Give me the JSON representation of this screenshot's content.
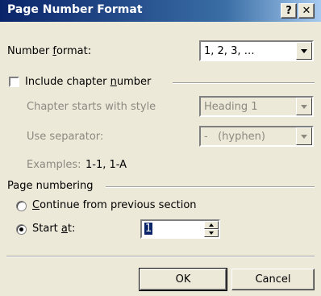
{
  "window": {
    "title": "Page Number Format",
    "help_label": "?",
    "close_label": "✕"
  },
  "number_format": {
    "label_pre": "Number ",
    "label_access": "f",
    "label_post": "ormat:",
    "value": "1, 2, 3, …"
  },
  "chapter": {
    "include_label_pre": "Include chapter ",
    "include_label_access": "n",
    "include_label_post": "umber",
    "include_checked": false,
    "starts_with_label": "Chapter starts with style",
    "starts_with_value": "Heading 1",
    "separator_label": "Use separator:",
    "separator_value": "-   (hyphen)",
    "examples_label": "Examples:",
    "examples_value": "1-1, 1-A"
  },
  "page_numbering": {
    "group_label": "Page numbering",
    "continue_label_access": "C",
    "continue_label_post": "ontinue from previous section",
    "start_at_label_pre": "Start ",
    "start_at_label_access": "a",
    "start_at_label_post": "t:",
    "selected": "start_at",
    "start_at_value": "1"
  },
  "buttons": {
    "ok": "OK",
    "cancel": "Cancel"
  },
  "colors": {
    "titlebar_start": "#0a246a",
    "titlebar_end": "#a6caf0",
    "dialog_face": "#ece9d8",
    "disabled_text": "#8c8a80"
  }
}
